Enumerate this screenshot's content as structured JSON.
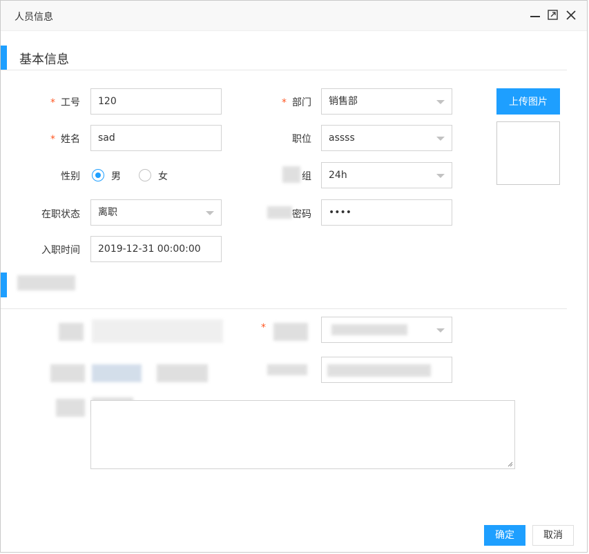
{
  "window": {
    "title": "人员信息",
    "minimize_icon": "minimize-icon",
    "maximize_icon": "maximize-icon",
    "close_icon": "close-icon"
  },
  "section_basic": {
    "title": "基本信息"
  },
  "fields": {
    "employee_no": {
      "label": "工号",
      "value": "120",
      "required": "*"
    },
    "name": {
      "label": "姓名",
      "value": "sad",
      "required": "*"
    },
    "gender": {
      "label": "性别",
      "options": [
        "男",
        "女"
      ],
      "selected": "男"
    },
    "employment_status": {
      "label": "在职状态",
      "value": "离职"
    },
    "hire_time": {
      "label": "入职时间",
      "value": "2019-12-31 00:00:00"
    },
    "department": {
      "label": "部门",
      "value": "销售部",
      "required": "*"
    },
    "position": {
      "label": "职位",
      "value": "assss"
    },
    "group": {
      "label": "组",
      "value": "24h"
    },
    "password": {
      "label": "密码",
      "value": "••••"
    }
  },
  "upload": {
    "label": "上传图片"
  },
  "section_second": {
    "required": "*"
  },
  "footer": {
    "confirm": "确定",
    "cancel": "取消"
  },
  "colors": {
    "accent": "#1e9fff",
    "required": "#ff5722"
  }
}
